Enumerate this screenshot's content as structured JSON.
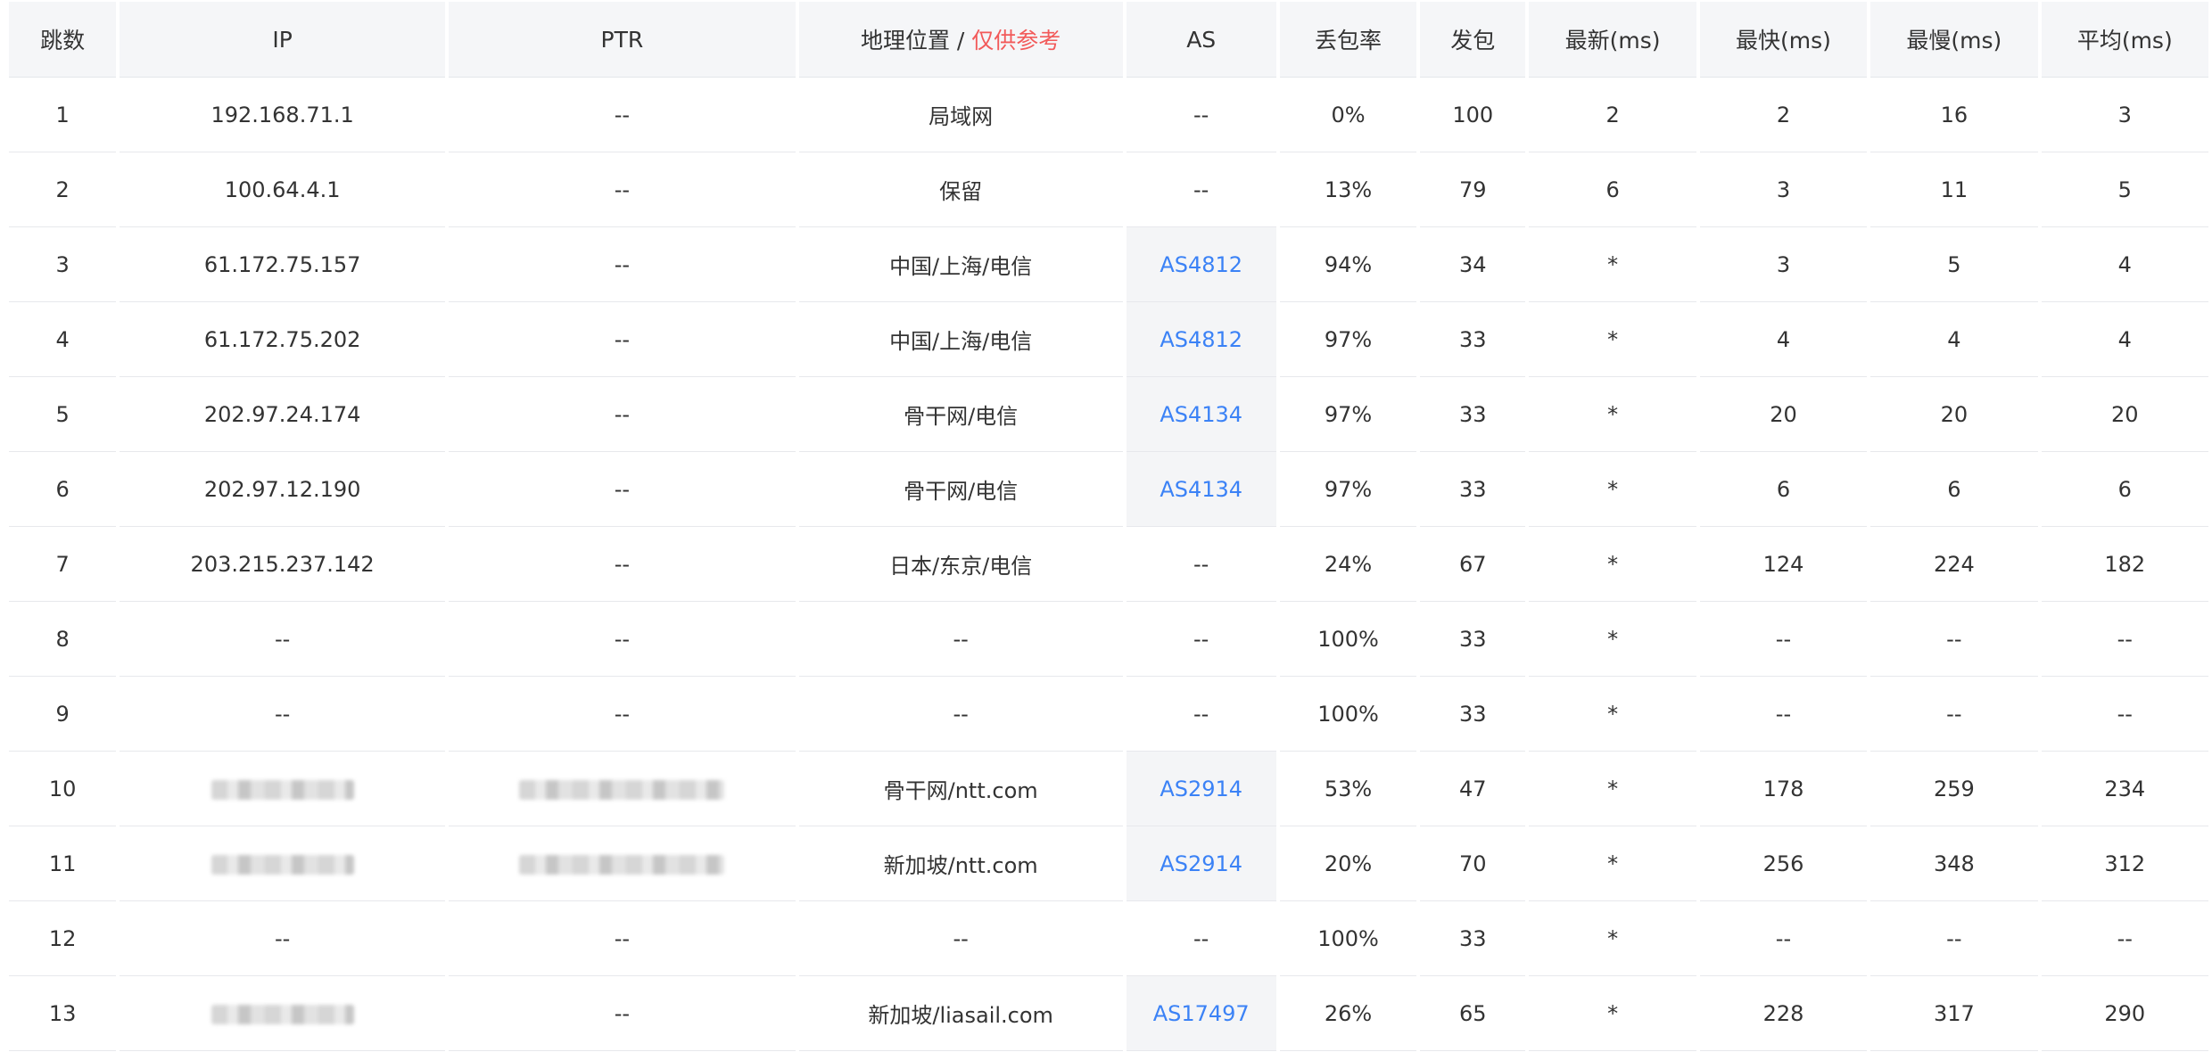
{
  "headers": {
    "hop": "跳数",
    "ip": "IP",
    "ptr": "PTR",
    "geo_main": "地理位置 / ",
    "geo_warn": "仅供参考",
    "as": "AS",
    "loss": "丢包率",
    "sent": "发包",
    "last": "最新(ms)",
    "best": "最快(ms)",
    "worst": "最慢(ms)",
    "avg": "平均(ms)"
  },
  "colors": {
    "warn": "#f25a5a",
    "link": "#3b82f6",
    "header_bg": "#f5f6f8",
    "as_cell_bg": "#f4f5f7"
  },
  "rows": [
    {
      "hop": "1",
      "ip": "192.168.71.1",
      "ptr": "--",
      "geo": "局域网",
      "as": "--",
      "loss": "0%",
      "sent": "100",
      "last": "2",
      "best": "2",
      "worst": "16",
      "avg": "3"
    },
    {
      "hop": "2",
      "ip": "100.64.4.1",
      "ptr": "--",
      "geo": "保留",
      "as": "--",
      "loss": "13%",
      "sent": "79",
      "last": "6",
      "best": "3",
      "worst": "11",
      "avg": "5"
    },
    {
      "hop": "3",
      "ip": "61.172.75.157",
      "ptr": "--",
      "geo": "中国/上海/电信",
      "as": "AS4812",
      "loss": "94%",
      "sent": "34",
      "last": "*",
      "best": "3",
      "worst": "5",
      "avg": "4"
    },
    {
      "hop": "4",
      "ip": "61.172.75.202",
      "ptr": "--",
      "geo": "中国/上海/电信",
      "as": "AS4812",
      "loss": "97%",
      "sent": "33",
      "last": "*",
      "best": "4",
      "worst": "4",
      "avg": "4"
    },
    {
      "hop": "5",
      "ip": "202.97.24.174",
      "ptr": "--",
      "geo": "骨干网/电信",
      "as": "AS4134",
      "loss": "97%",
      "sent": "33",
      "last": "*",
      "best": "20",
      "worst": "20",
      "avg": "20"
    },
    {
      "hop": "6",
      "ip": "202.97.12.190",
      "ptr": "--",
      "geo": "骨干网/电信",
      "as": "AS4134",
      "loss": "97%",
      "sent": "33",
      "last": "*",
      "best": "6",
      "worst": "6",
      "avg": "6"
    },
    {
      "hop": "7",
      "ip": "203.215.237.142",
      "ptr": "--",
      "geo": "日本/东京/电信",
      "as": "--",
      "loss": "24%",
      "sent": "67",
      "last": "*",
      "best": "124",
      "worst": "224",
      "avg": "182"
    },
    {
      "hop": "8",
      "ip": "--",
      "ptr": "--",
      "geo": "--",
      "as": "--",
      "loss": "100%",
      "sent": "33",
      "last": "*",
      "best": "--",
      "worst": "--",
      "avg": "--"
    },
    {
      "hop": "9",
      "ip": "--",
      "ptr": "--",
      "geo": "--",
      "as": "--",
      "loss": "100%",
      "sent": "33",
      "last": "*",
      "best": "--",
      "worst": "--",
      "avg": "--"
    },
    {
      "hop": "10",
      "ip": "",
      "ip_redacted": true,
      "ptr": "",
      "ptr_redacted": true,
      "geo": "骨干网/ntt.com",
      "as": "AS2914",
      "loss": "53%",
      "sent": "47",
      "last": "*",
      "best": "178",
      "worst": "259",
      "avg": "234"
    },
    {
      "hop": "11",
      "ip": "",
      "ip_redacted": true,
      "ptr": "",
      "ptr_redacted": true,
      "geo": "新加坡/ntt.com",
      "as": "AS2914",
      "loss": "20%",
      "sent": "70",
      "last": "*",
      "best": "256",
      "worst": "348",
      "avg": "312"
    },
    {
      "hop": "12",
      "ip": "--",
      "ptr": "--",
      "geo": "--",
      "as": "--",
      "loss": "100%",
      "sent": "33",
      "last": "*",
      "best": "--",
      "worst": "--",
      "avg": "--"
    },
    {
      "hop": "13",
      "ip": "",
      "ip_redacted": true,
      "ptr": "--",
      "geo": "新加坡/liasail.com",
      "as": "AS17497",
      "loss": "26%",
      "sent": "65",
      "last": "*",
      "best": "228",
      "worst": "317",
      "avg": "290"
    }
  ]
}
